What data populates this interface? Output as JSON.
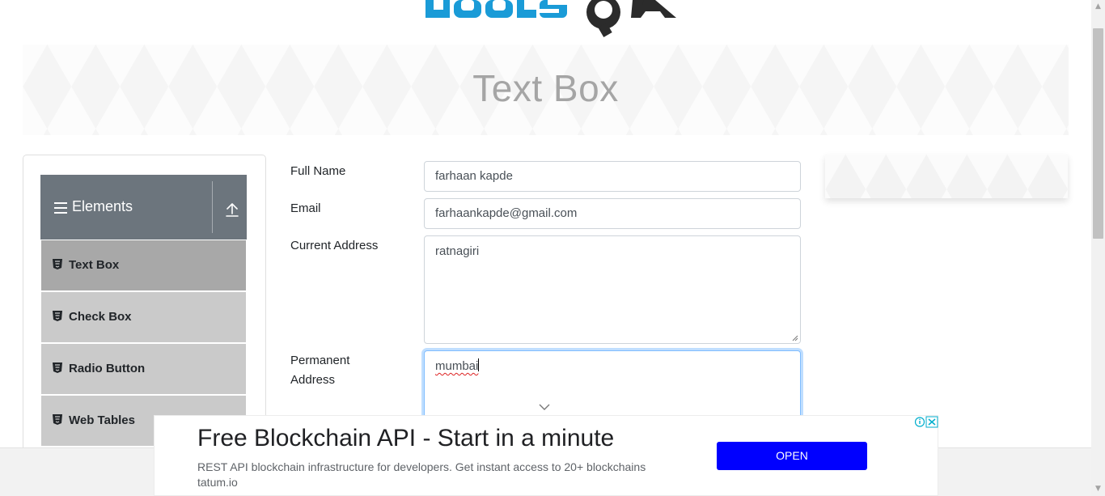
{
  "header": {
    "logo_alt": "ToolsQA"
  },
  "banner": {
    "title": "Text Box"
  },
  "sidebar": {
    "group_title": "Elements",
    "items": [
      {
        "label": "Text Box",
        "active": true
      },
      {
        "label": "Check Box",
        "active": false
      },
      {
        "label": "Radio Button",
        "active": false
      },
      {
        "label": "Web Tables",
        "active": false
      }
    ]
  },
  "form": {
    "full_name": {
      "label": "Full Name",
      "value": "farhaan kapde"
    },
    "email": {
      "label": "Email",
      "value": "farhaankapde@gmail.com"
    },
    "current_address": {
      "label": "Current Address",
      "value": "ratnagiri"
    },
    "permanent_address": {
      "label_line1": "Permanent",
      "label_line2": "Address",
      "value": "mumbai"
    }
  },
  "ad": {
    "headline": "Free Blockchain API - Start in a minute",
    "body": "REST API blockchain infrastructure for developers. Get instant access to 20+ blockchains tatum.io",
    "button_label": "OPEN"
  },
  "colors": {
    "logo_blue": "#1a9bd7",
    "logo_dark": "#2b2b2b",
    "sidebar_header": "#6c757d",
    "menu_active": "#a8a8a8",
    "menu_item": "#cacaca",
    "focus_border": "#80bdff",
    "ad_button": "#0000ff"
  }
}
